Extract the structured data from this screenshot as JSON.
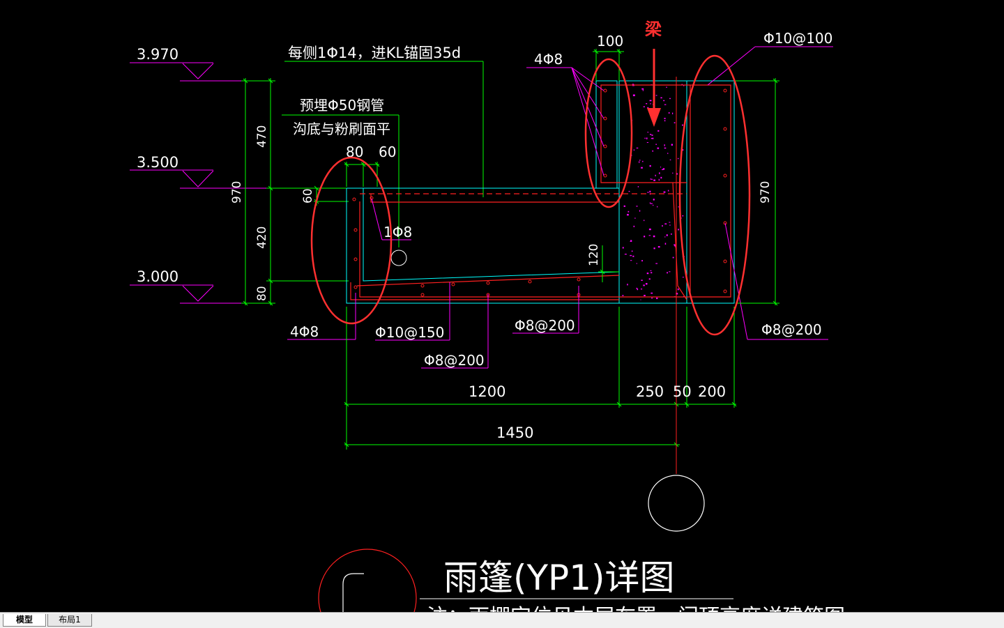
{
  "colors": {
    "background": "#000000",
    "white": "#ffffff",
    "green": "#00ff00",
    "magenta": "#ff00ff",
    "red": "#ff0000",
    "cyan": "#00ffff",
    "annotation_red": "#ff3030"
  },
  "drawing": {
    "title": "雨篷(YP1)详图",
    "subtitle_partial": "注：雨棚定位见本层布置，门顶高度详建筑图",
    "beam_label": "梁",
    "elevations": [
      "3.970",
      "3.500",
      "3.000"
    ],
    "rebar_notes": {
      "top_anchor": "每侧1Φ14，进KL锚固35d",
      "pipe_line1": "预埋Φ50钢管",
      "pipe_line2": "沟底与粉刷面平",
      "beam_4phi8": "4Φ8",
      "stirrup_top_right": "Φ10@100",
      "one_phi8": "1Φ8",
      "left_4phi8": "4Φ8",
      "phi10_150": "Φ10@150",
      "phi8_200_a": "Φ8@200",
      "phi8_200_b": "Φ8@200",
      "phi8_200_right": "Φ8@200"
    },
    "dimensions": {
      "d100": "100",
      "d470": "470",
      "d970_left": "970",
      "d420": "420",
      "d80_left": "80",
      "d80_top": "80",
      "d60_top": "60",
      "d60_side": "60",
      "d120": "120",
      "d970_right": "970",
      "d1200": "1200",
      "d250": "250",
      "d50": "50",
      "d200": "200",
      "d1450": "1450"
    }
  },
  "tabs": [
    {
      "label": "模型",
      "active": true
    },
    {
      "label": "布局1",
      "active": false
    }
  ]
}
